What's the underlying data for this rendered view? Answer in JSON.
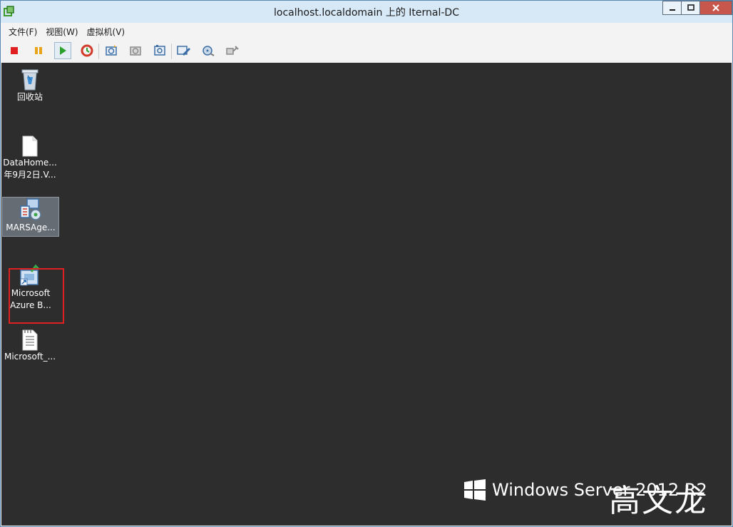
{
  "window": {
    "title": "localhost.localdomain 上的 Iternal-DC"
  },
  "menu": {
    "items": [
      "文件(F)",
      "视图(W)",
      "虚拟机(V)"
    ]
  },
  "toolbar": {
    "buttons": [
      {
        "icon": "stop-icon",
        "color": "#e02020"
      },
      {
        "icon": "pause-icon",
        "color": "#e8a317"
      },
      {
        "icon": "play-icon",
        "color": "#2ca02c"
      },
      {
        "icon": "reset-icon",
        "color": "#d23a2a"
      },
      {
        "icon": "snapshot-icon"
      },
      {
        "icon": "revert-snapshot-icon"
      },
      {
        "icon": "snapshot-manager-icon"
      },
      {
        "icon": "edit-settings-icon"
      },
      {
        "icon": "cd-drive-icon"
      },
      {
        "icon": "connect-device-icon"
      }
    ]
  },
  "desktop": {
    "icons": [
      {
        "name": "recycle-bin",
        "label": "回收站",
        "icon": "recycle-bin-icon"
      },
      {
        "name": "datahome-file",
        "label_line1": "DataHome...",
        "label_line2": "年9月2日.V...",
        "icon": "file-icon"
      },
      {
        "name": "marsagent",
        "label": "MARSAge...",
        "icon": "installer-icon",
        "selected": true
      },
      {
        "name": "azure-backup",
        "label_line1": "Microsoft",
        "label_line2": "Azure B...",
        "icon": "azure-backup-shortcut-icon",
        "highlighted": true
      },
      {
        "name": "microsoft-text",
        "label": "Microsoft_...",
        "icon": "text-document-icon"
      }
    ],
    "background": "#2d2d2d"
  },
  "branding": {
    "product": "Windows Server 2012 R2"
  },
  "watermark": "高文龙",
  "colors": {
    "titlebar": "#d7e8f7",
    "highlight": "#e02020"
  }
}
